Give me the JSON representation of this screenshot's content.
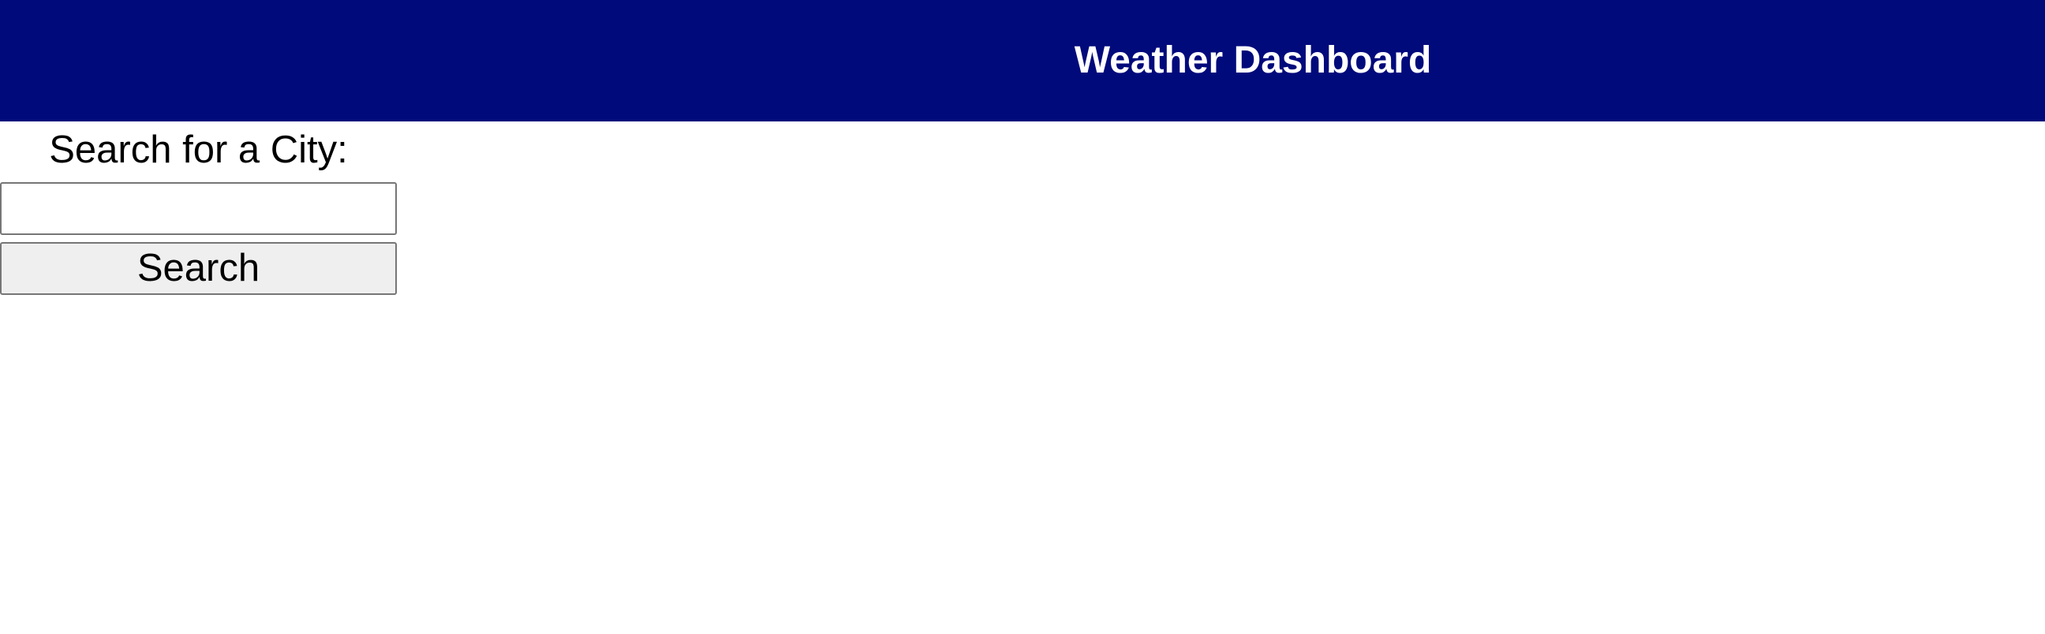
{
  "header": {
    "title": "Weather Dashboard",
    "background_color": "#000a7b",
    "text_color": "#ffffff"
  },
  "search": {
    "label": "Search for a City:",
    "input_value": "",
    "placeholder": "",
    "button_label": "Search"
  }
}
